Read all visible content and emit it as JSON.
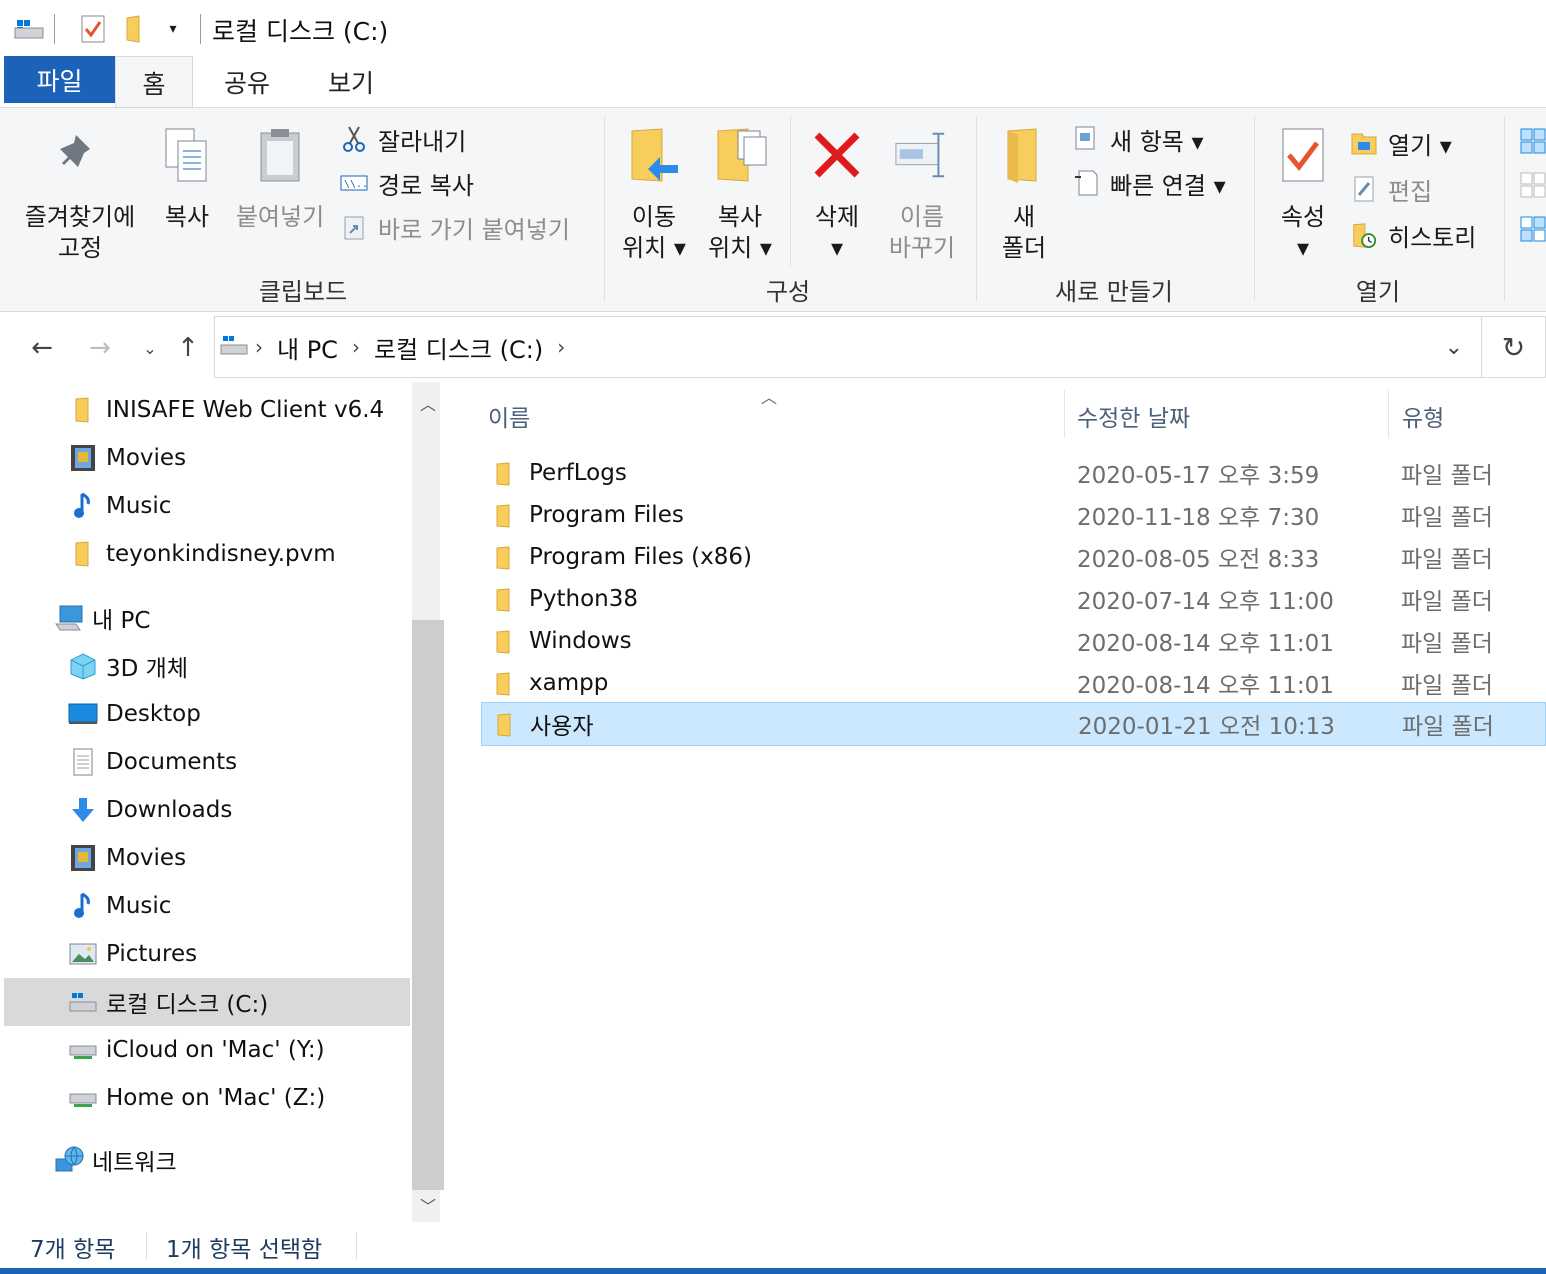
{
  "window": {
    "title": "로컬 디스크 (C:)"
  },
  "tabs": {
    "file": "파일",
    "home": "홈",
    "share": "공유",
    "view": "보기"
  },
  "ribbon": {
    "clipboard": {
      "pin": "즐겨찾기에\n고정",
      "copy": "복사",
      "paste": "붙여넣기",
      "cut": "잘라내기",
      "copy_path": "경로 복사",
      "paste_shortcut": "바로 가기 붙여넣기",
      "label": "클립보드"
    },
    "organize": {
      "move_to": "이동\n위치 ▾",
      "copy_to": "복사\n위치 ▾",
      "delete": "삭제\n▾",
      "rename": "이름\n바꾸기",
      "label": "구성"
    },
    "new": {
      "new_folder": "새\n폴더",
      "new_item": "새 항목 ▾",
      "easy_access": "빠른 연결 ▾",
      "label": "새로 만들기"
    },
    "open": {
      "properties": "속성\n▾",
      "open": "열기 ▾",
      "edit": "편집",
      "history": "히스토리",
      "label": "열기"
    }
  },
  "address": {
    "segments": [
      "내 PC",
      "로컬 디스크 (C:)"
    ]
  },
  "navpane": {
    "items": [
      {
        "label": "INISAFE Web Client v6.4",
        "icon": "folder-icon"
      },
      {
        "label": "Movies",
        "icon": "movies-icon"
      },
      {
        "label": "Music",
        "icon": "music-icon"
      },
      {
        "label": "teyonkindisney.pvm",
        "icon": "folder-icon"
      },
      {
        "label": "내 PC",
        "icon": "pc-icon"
      },
      {
        "label": "3D 개체",
        "icon": "3d-objects-icon"
      },
      {
        "label": "Desktop",
        "icon": "desktop-icon"
      },
      {
        "label": "Documents",
        "icon": "documents-icon"
      },
      {
        "label": "Downloads",
        "icon": "downloads-icon"
      },
      {
        "label": "Movies",
        "icon": "movies-icon"
      },
      {
        "label": "Music",
        "icon": "music-icon"
      },
      {
        "label": "Pictures",
        "icon": "pictures-icon"
      },
      {
        "label": "로컬 디스크 (C:)",
        "icon": "local-disk-icon"
      },
      {
        "label": "iCloud on 'Mac' (Y:)",
        "icon": "network-drive-icon"
      },
      {
        "label": "Home on 'Mac' (Z:)",
        "icon": "network-drive-icon"
      },
      {
        "label": "네트워크",
        "icon": "network-icon"
      }
    ]
  },
  "content": {
    "columns": {
      "name": "이름",
      "date": "수정한 날짜",
      "type": "유형"
    },
    "rows": [
      {
        "name": "PerfLogs",
        "date": "2020-05-17 오후 3:59",
        "type": "파일 폴더"
      },
      {
        "name": "Program Files",
        "date": "2020-11-18 오후 7:30",
        "type": "파일 폴더"
      },
      {
        "name": "Program Files (x86)",
        "date": "2020-08-05 오전 8:33",
        "type": "파일 폴더"
      },
      {
        "name": "Python38",
        "date": "2020-07-14 오후 11:00",
        "type": "파일 폴더"
      },
      {
        "name": "Windows",
        "date": "2020-08-14 오후 11:01",
        "type": "파일 폴더"
      },
      {
        "name": "xampp",
        "date": "2020-08-14 오후 11:01",
        "type": "파일 폴더"
      },
      {
        "name": "사용자",
        "date": "2020-01-21 오전 10:13",
        "type": "파일 폴더"
      }
    ]
  },
  "status": {
    "count": "7개 항목",
    "selected": "1개 항목 선택함"
  },
  "colors": {
    "accent": "#1b62b8",
    "selection": "#cce8ff",
    "folder": "#f7cd5b"
  }
}
